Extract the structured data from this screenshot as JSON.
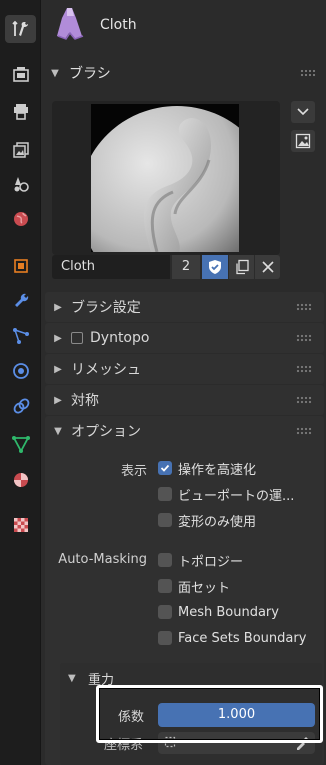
{
  "tabs": [
    {
      "name": "tool-tab",
      "active": true
    },
    {
      "name": "render-tab"
    },
    {
      "name": "output-tab"
    },
    {
      "name": "view-layer-tab"
    },
    {
      "name": "scene-tab"
    },
    {
      "name": "world-tab"
    },
    {
      "name": "object-tab"
    },
    {
      "name": "modifier-tab"
    },
    {
      "name": "particles-tab"
    },
    {
      "name": "physics-tab"
    },
    {
      "name": "constraints-tab"
    },
    {
      "name": "data-tab"
    },
    {
      "name": "material-tab"
    },
    {
      "name": "texture-tab"
    }
  ],
  "header": {
    "object_name": "Cloth"
  },
  "brush_panel": {
    "title": "ブラシ",
    "brush_name": "Cloth",
    "users": "2"
  },
  "subpanels": {
    "brush_settings": "ブラシ設定",
    "dyntopo": "Dyntopo",
    "remesh": "リメッシュ",
    "symmetry": "対称",
    "options": "オプション"
  },
  "options": {
    "display_label": "表示",
    "display_items": [
      {
        "label": "操作を高速化",
        "checked": true
      },
      {
        "label": "ビューポートの運...",
        "checked": false
      },
      {
        "label": "変形のみ使用",
        "checked": false
      }
    ],
    "automask_label": "Auto-Masking",
    "automask_items": [
      {
        "label": "トポロジー",
        "checked": false
      },
      {
        "label": "面セット",
        "checked": false
      },
      {
        "label": "Mesh Boundary",
        "checked": false
      },
      {
        "label": "Face Sets Boundary",
        "checked": false
      }
    ],
    "gravity_title": "重力",
    "factor_label": "係数",
    "factor_value": "1.000",
    "coord_label": "座標系"
  },
  "colors": {
    "accent": "#4772b3",
    "panel": "#2b2b2b",
    "subpanel": "#303030"
  }
}
